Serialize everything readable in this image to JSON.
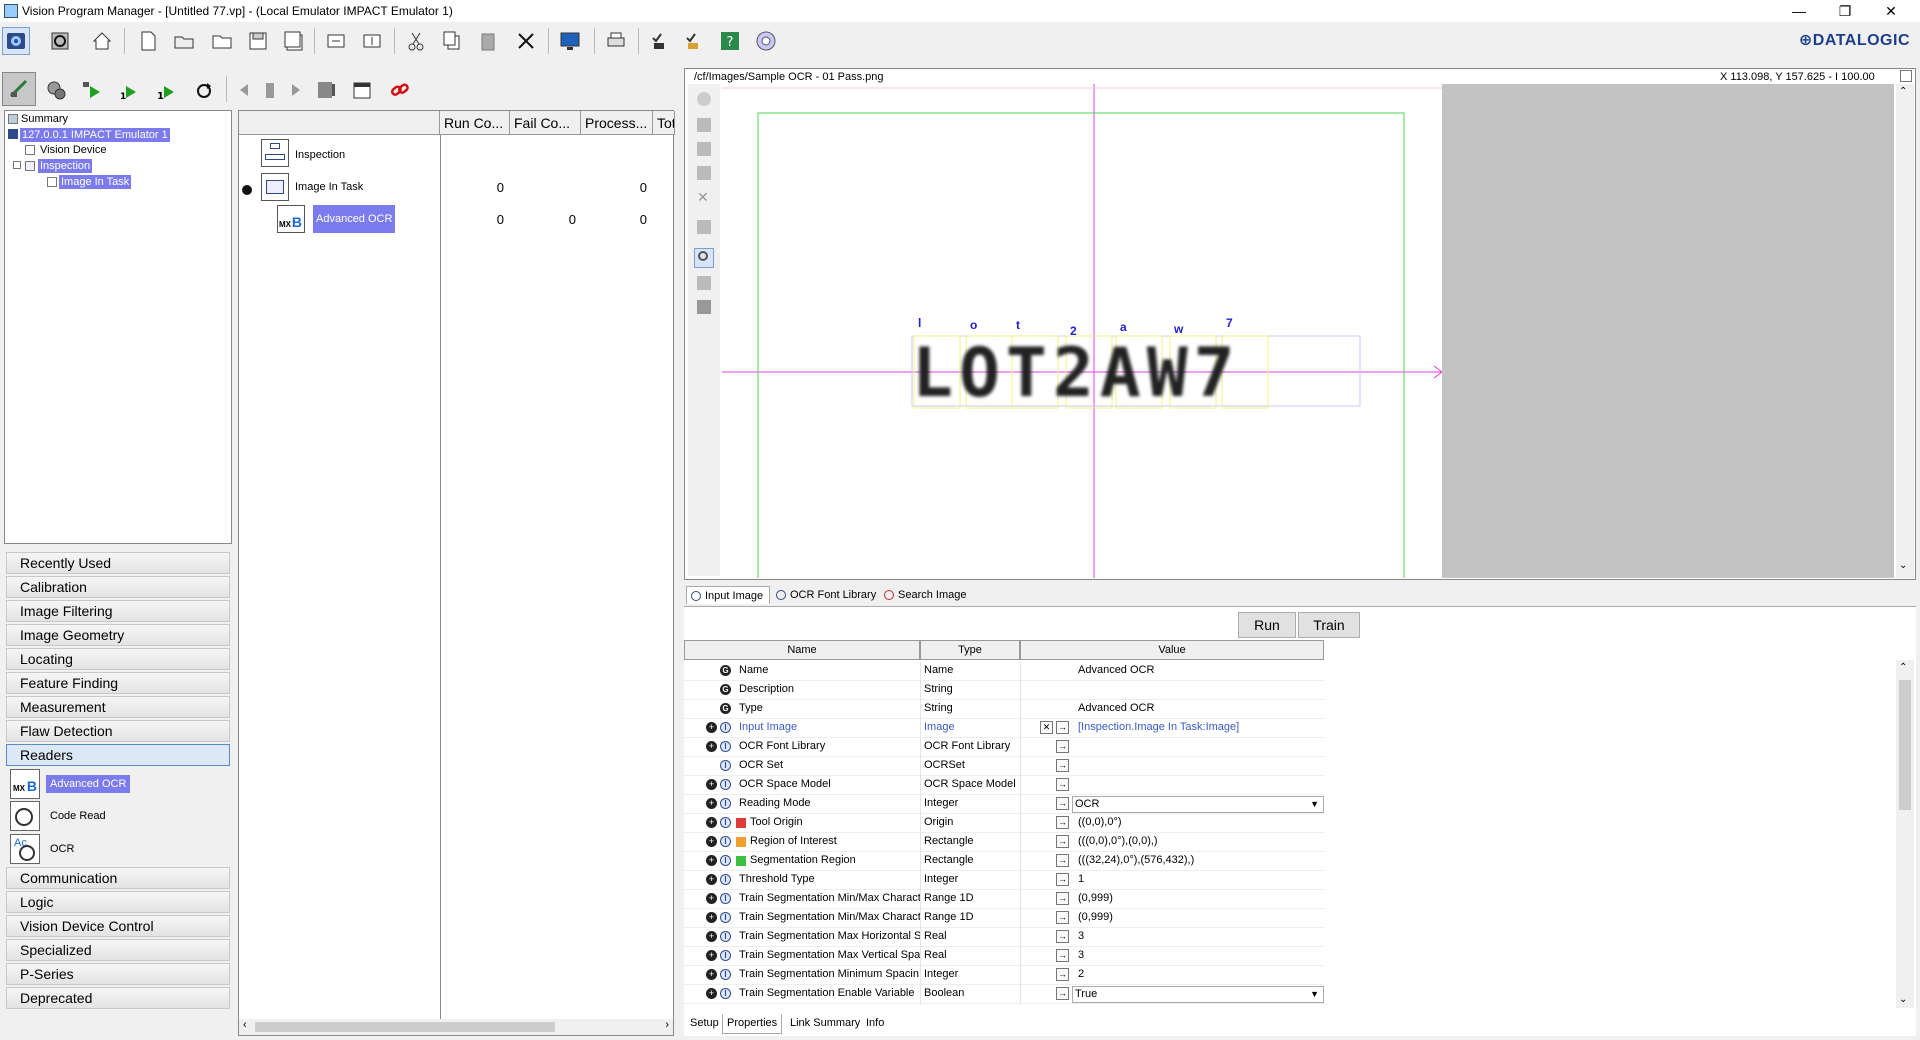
{
  "window": {
    "title": "Vision Program Manager - [Untitled 77.vp] - (Local Emulator IMPACT Emulator 1)",
    "minimize": "—",
    "restore": "❐",
    "close": "✕"
  },
  "brand": "DATALOGIC",
  "tree": {
    "root": "Summary",
    "device": "127.0.0.1 IMPACT Emulator 1",
    "vision_device": "Vision Device",
    "inspection": "Inspection",
    "image_task": "Image In Task"
  },
  "categories": {
    "recently_used": "Recently Used",
    "calibration": "Calibration",
    "image_filtering": "Image Filtering",
    "image_geometry": "Image Geometry",
    "locating": "Locating",
    "feature_finding": "Feature Finding",
    "measurement": "Measurement",
    "flaw_detection": "Flaw Detection",
    "readers": "Readers",
    "communication": "Communication",
    "logic": "Logic",
    "vision_device_control": "Vision Device Control",
    "specialized": "Specialized",
    "p_series": "P-Series",
    "deprecated": "Deprecated"
  },
  "reader_tools": [
    "Advanced OCR",
    "Code Read",
    "OCR"
  ],
  "grid": {
    "headers": [
      "Run Co...",
      "Fail Co...",
      "Process...",
      "Tot"
    ],
    "rows": [
      {
        "name": "Inspection",
        "run": "",
        "fail": "",
        "process": ""
      },
      {
        "name": "Image In Task",
        "run": "0",
        "fail": "",
        "process": "0"
      },
      {
        "name": "Advanced OCR",
        "run": "0",
        "fail": "0",
        "process": "0"
      }
    ]
  },
  "image": {
    "path": "/cf/Images/Sample OCR - 01 Pass.png",
    "coords": "X 113.098, Y 157.625 - I 100.00",
    "ocr_text": "LOT2AW7",
    "ocr_labels": [
      "l",
      "o",
      "t",
      "2",
      "a",
      "w",
      "7"
    ]
  },
  "image_tabs": [
    "Input Image",
    "OCR Font Library",
    "Search Image"
  ],
  "buttons": {
    "run": "Run",
    "train": "Train"
  },
  "props": {
    "headers": {
      "name": "Name",
      "type": "Type",
      "value": "Value"
    },
    "rows": [
      {
        "name": "Name",
        "type": "Name",
        "value": "Advanced OCR"
      },
      {
        "name": "Description",
        "type": "String",
        "value": ""
      },
      {
        "name": "Type",
        "type": "String",
        "value": "Advanced OCR"
      },
      {
        "name": "Input Image",
        "type": "Image",
        "value": "[Inspection.Image In Task:Image]"
      },
      {
        "name": "OCR Font Library",
        "type": "OCR Font Library",
        "value": ""
      },
      {
        "name": "OCR Set",
        "type": "OCRSet",
        "value": ""
      },
      {
        "name": "OCR Space Model",
        "type": "OCR Space Model",
        "value": ""
      },
      {
        "name": "Reading Mode",
        "type": "Integer",
        "value": "OCR"
      },
      {
        "name": "Tool Origin",
        "type": "Origin",
        "value": "((0,0),0°)"
      },
      {
        "name": "Region of Interest",
        "type": "Rectangle",
        "value": "(((0,0),0°),(0,0),)"
      },
      {
        "name": "Segmentation Region",
        "type": "Rectangle",
        "value": "(((32,24),0°),(576,432),)"
      },
      {
        "name": "Threshold Type",
        "type": "Integer",
        "value": "1"
      },
      {
        "name": "Train Segmentation Min/Max Charact",
        "type": "Range 1D",
        "value": "(0,999)"
      },
      {
        "name": "Train Segmentation Min/Max Charact",
        "type": "Range 1D",
        "value": "(0,999)"
      },
      {
        "name": "Train Segmentation Max Horizontal S",
        "type": "Real",
        "value": "3"
      },
      {
        "name": "Train Segmentation Max Vertical Spa",
        "type": "Real",
        "value": "3"
      },
      {
        "name": "Train Segmentation Minimum Spacin",
        "type": "Integer",
        "value": "2"
      },
      {
        "name": "Train Segmentation Enable Variable",
        "type": "Boolean",
        "value": "True"
      }
    ]
  },
  "bottom_tabs": [
    "Setup",
    "Properties",
    "Link Summary",
    "Info"
  ],
  "colors": {
    "selection": "#7b7bee",
    "tool_origin": "#e03b3b",
    "roi": "#f0a030",
    "segmentation": "#3cc040",
    "guide_magenta": "#e040e0",
    "guide_green": "#50d050"
  }
}
